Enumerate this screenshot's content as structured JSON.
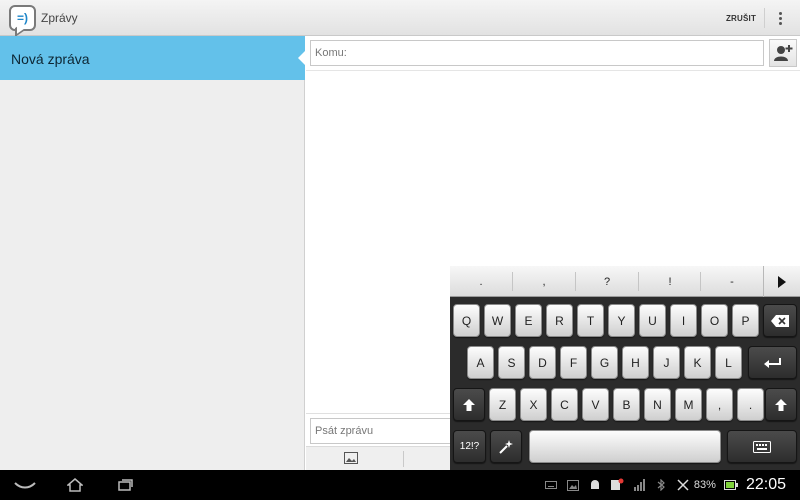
{
  "actionbar": {
    "app_title": "Zprávy",
    "app_icon": "messaging-icon",
    "cancel_label": "ZRUŠIT",
    "overflow_icon": "overflow-menu-icon"
  },
  "conversations": {
    "items": [
      {
        "label": "Nová zpráva",
        "selected": true
      }
    ],
    "selected_color": "#63c1ea"
  },
  "compose": {
    "to_placeholder": "Komu:",
    "to_value": "",
    "add_contact_icon": "add-contact-icon",
    "message_placeholder": "Psát zprávu",
    "message_value": "",
    "attach_icon": "image-attach-icon"
  },
  "keyboard": {
    "suggestions": [
      ".",
      ",",
      "?",
      "!",
      "-"
    ],
    "more_icon": "play-right-icon",
    "row1": [
      "Q",
      "W",
      "E",
      "R",
      "T",
      "Y",
      "U",
      "I",
      "O",
      "P"
    ],
    "row2": [
      "A",
      "S",
      "D",
      "F",
      "G",
      "H",
      "J",
      "K",
      "L"
    ],
    "row3": [
      "Z",
      "X",
      "C",
      "V",
      "B",
      "N",
      "M",
      ",",
      "."
    ],
    "symbols_label": "12!?",
    "backspace_icon": "backspace-icon",
    "enter_icon": "enter-icon",
    "shift_icon": "shift-icon",
    "magic_icon": "magic-wand-icon",
    "hide_icon": "keyboard-hide-icon"
  },
  "navbar": {
    "back_icon": "back-icon",
    "home_icon": "home-icon",
    "recents_icon": "recent-apps-icon"
  },
  "statusbar": {
    "battery_percent": "83%",
    "time": "22:05",
    "battery_color": "#7fd13b"
  }
}
